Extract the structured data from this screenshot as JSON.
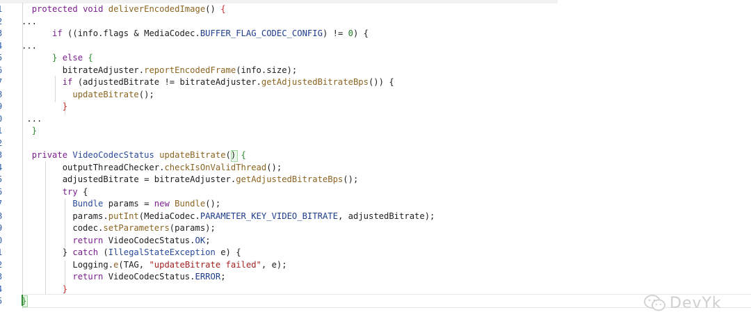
{
  "editor": {
    "lines": [
      {
        "n": "1",
        "tokens": [
          [
            "  ",
            "plain"
          ],
          [
            "protected ",
            "kw"
          ],
          [
            "void ",
            "kw"
          ],
          [
            "deliverEncodedImage",
            "fn"
          ],
          [
            "() ",
            "plain"
          ],
          [
            "{",
            "br-red"
          ]
        ]
      },
      {
        "n": "2",
        "tokens": [
          [
            "...",
            "plain"
          ]
        ]
      },
      {
        "n": "3",
        "tokens": [
          [
            "      ",
            "plain"
          ],
          [
            "if ",
            "kw"
          ],
          [
            "((info.flags & MediaCodec.",
            "plain"
          ],
          [
            "BUFFER_FLAG_CODEC_CONFIG",
            "const"
          ],
          [
            ") != ",
            "plain"
          ],
          [
            "0",
            "num"
          ],
          [
            ") {",
            "plain"
          ]
        ]
      },
      {
        "n": "4",
        "tokens": [
          [
            "...",
            "plain"
          ]
        ]
      },
      {
        "n": "5",
        "tokens": [
          [
            "      ",
            "plain"
          ],
          [
            "} ",
            "br-green"
          ],
          [
            "else ",
            "kw"
          ],
          [
            "{",
            "br-green"
          ]
        ]
      },
      {
        "n": "6",
        "tokens": [
          [
            "        bitrateAdjuster.",
            "plain"
          ],
          [
            "reportEncodedFrame",
            "fn"
          ],
          [
            "(info.size);",
            "plain"
          ]
        ]
      },
      {
        "n": "7",
        "tokens": [
          [
            "        ",
            "plain"
          ],
          [
            "if ",
            "kw"
          ],
          [
            "(adjustedBitrate != bitrateAdjuster.",
            "plain"
          ],
          [
            "getAdjustedBitrateBps",
            "fn"
          ],
          [
            "()) {",
            "plain"
          ]
        ]
      },
      {
        "n": "8",
        "tokens": [
          [
            "          ",
            "plain"
          ],
          [
            "updateBitrate",
            "fn"
          ],
          [
            "();",
            "plain"
          ]
        ]
      },
      {
        "n": "9",
        "tokens": [
          [
            "        ",
            "plain"
          ],
          [
            "}",
            "br-red"
          ]
        ]
      },
      {
        "n": "0",
        "tokens": [
          [
            " ...",
            "plain"
          ]
        ]
      },
      {
        "n": "1",
        "tokens": [
          [
            "  ",
            "plain"
          ],
          [
            "}",
            "br-green"
          ]
        ]
      },
      {
        "n": "2",
        "tokens": [
          [
            "",
            "plain"
          ]
        ]
      },
      {
        "n": "3",
        "tokens": [
          [
            "  ",
            "plain"
          ],
          [
            "private ",
            "kw"
          ],
          [
            "VideoCodecStatus ",
            "type"
          ],
          [
            "updateBitrate",
            "fn"
          ],
          [
            "() ",
            "plain"
          ],
          [
            "{",
            "br-green"
          ]
        ]
      },
      {
        "n": "4",
        "tokens": [
          [
            "        outputThreadChecker.",
            "plain"
          ],
          [
            "checkIsOnValidThread",
            "fn"
          ],
          [
            "();",
            "plain"
          ]
        ]
      },
      {
        "n": "5",
        "tokens": [
          [
            "        adjustedBitrate = bitrateAdjuster.",
            "plain"
          ],
          [
            "getAdjustedBitrateBps",
            "fn"
          ],
          [
            "();",
            "plain"
          ]
        ]
      },
      {
        "n": "6",
        "tokens": [
          [
            "        ",
            "plain"
          ],
          [
            "try ",
            "kw"
          ],
          [
            "{",
            "plain"
          ]
        ]
      },
      {
        "n": "7",
        "tokens": [
          [
            "          ",
            "plain"
          ],
          [
            "Bundle ",
            "type"
          ],
          [
            "params = ",
            "plain"
          ],
          [
            "new ",
            "kw"
          ],
          [
            "Bundle",
            "fn"
          ],
          [
            "();",
            "plain"
          ]
        ]
      },
      {
        "n": "8",
        "tokens": [
          [
            "          params.",
            "plain"
          ],
          [
            "putInt",
            "fn"
          ],
          [
            "(MediaCodec.",
            "plain"
          ],
          [
            "PARAMETER_KEY_VIDEO_BITRATE",
            "const"
          ],
          [
            ", adjustedBitrate);",
            "plain"
          ]
        ]
      },
      {
        "n": "9",
        "tokens": [
          [
            "          codec.",
            "plain"
          ],
          [
            "setParameters",
            "fn"
          ],
          [
            "(params);",
            "plain"
          ]
        ]
      },
      {
        "n": "0",
        "tokens": [
          [
            "          ",
            "plain"
          ],
          [
            "return ",
            "kw"
          ],
          [
            "VideoCodecStatus.",
            "plain"
          ],
          [
            "OK",
            "const"
          ],
          [
            ";",
            "plain"
          ]
        ]
      },
      {
        "n": "1",
        "tokens": [
          [
            "        } ",
            "plain"
          ],
          [
            "catch ",
            "kw"
          ],
          [
            "(",
            "plain"
          ],
          [
            "IllegalStateException ",
            "type"
          ],
          [
            "e) {",
            "plain"
          ]
        ]
      },
      {
        "n": "2",
        "tokens": [
          [
            "          Logging.",
            "plain"
          ],
          [
            "e",
            "fn"
          ],
          [
            "(TAG, ",
            "plain"
          ],
          [
            "\"updateBitrate failed\"",
            "str"
          ],
          [
            ", e);",
            "plain"
          ]
        ]
      },
      {
        "n": "3",
        "tokens": [
          [
            "          ",
            "plain"
          ],
          [
            "return ",
            "kw"
          ],
          [
            "VideoCodecStatus.",
            "plain"
          ],
          [
            "ERROR",
            "const"
          ],
          [
            ";",
            "plain"
          ]
        ]
      },
      {
        "n": "4",
        "tokens": [
          [
            "        ",
            "plain"
          ],
          [
            "}",
            "br-red"
          ]
        ]
      },
      {
        "n": "5",
        "tokens": [
          [
            "}",
            "br-green"
          ]
        ]
      }
    ]
  },
  "watermark": {
    "text": "DevYk",
    "icon": "wechat-icon"
  }
}
